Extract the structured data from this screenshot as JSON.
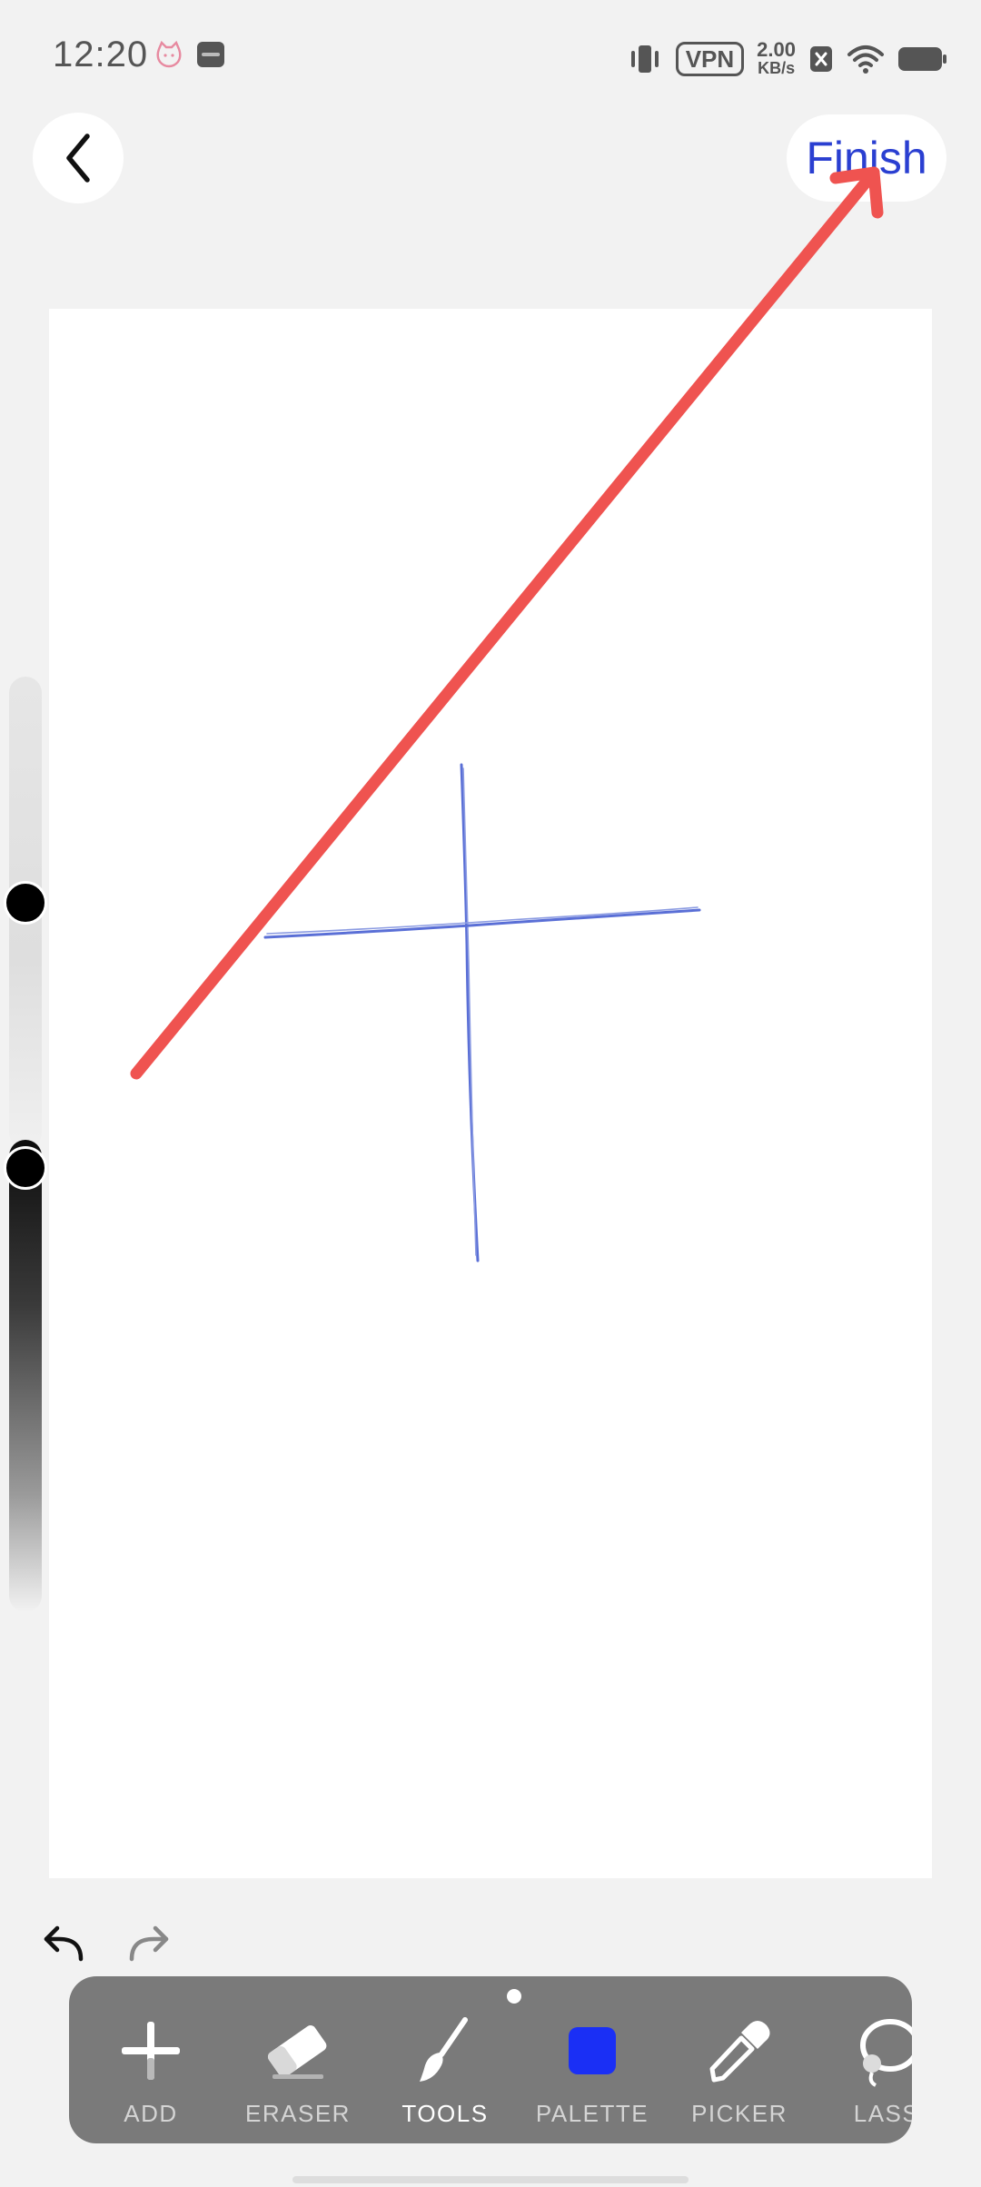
{
  "status_bar": {
    "time": "12:20",
    "vpn": "VPN",
    "net_speed_value": "2.00",
    "net_speed_unit": "KB/s",
    "icons": [
      "cat-notification-icon",
      "vivo-app-icon",
      "vibrate-icon",
      "sim-blocked-icon",
      "wifi-icon",
      "battery-icon"
    ]
  },
  "top_bar": {
    "back_icon": "chevron-left-icon",
    "finish_label": "Finish",
    "finish_color": "#2a3fd1"
  },
  "canvas": {
    "background": "#ffffff",
    "stroke_color": "#5a6fd6",
    "annotation_arrow_color": "#ef5350"
  },
  "sliders": {
    "size_label": "brush-size",
    "opacity_label": "brush-opacity"
  },
  "history": {
    "undo_icon": "undo-icon",
    "redo_icon": "redo-icon"
  },
  "toolbar": {
    "active_tool": "TOOLS",
    "palette_color": "#1a2ff5",
    "tools": [
      {
        "label": "ADD",
        "icon": "plus-icon"
      },
      {
        "label": "ERASER",
        "icon": "eraser-icon"
      },
      {
        "label": "TOOLS",
        "icon": "brush-icon"
      },
      {
        "label": "PALETTE",
        "icon": "palette-swatch-icon"
      },
      {
        "label": "PICKER",
        "icon": "eyedropper-icon"
      },
      {
        "label": "LASS",
        "icon": "lasso-icon"
      }
    ]
  }
}
